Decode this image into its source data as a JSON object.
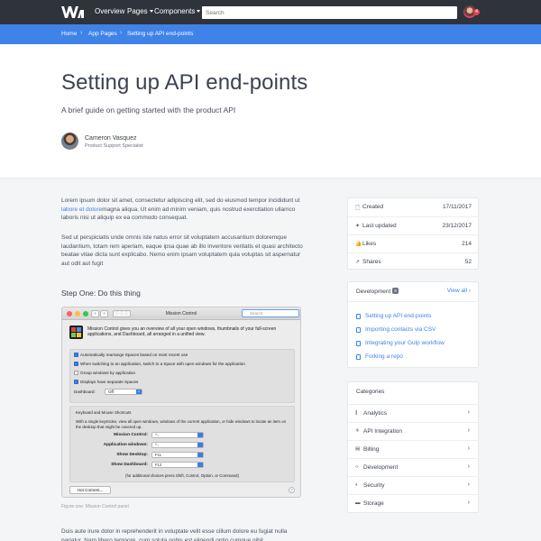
{
  "topbar": {
    "nav": [
      {
        "label": "Overview",
        "caret": false
      },
      {
        "label": "Pages",
        "caret": true
      },
      {
        "label": "Components",
        "caret": true
      }
    ],
    "search_placeholder": "Search",
    "notification_count": "4"
  },
  "breadcrumb": [
    "Home",
    "App Pages",
    "Setting up API end-points"
  ],
  "hero": {
    "title": "Setting up API end-points",
    "subtitle": "A brief guide on getting started with the product API",
    "author_name": "Cameron Vasquez",
    "author_role": "Product Support Specialist"
  },
  "article": {
    "p1_before": "Lorem ipsum dolor sit amet, consectetur adipiscing elit, sed do eiusmod tempor incididunt ut ",
    "p1_link": "labore et dolore",
    "p1_after": "magna aliqua. Ut enim ad minim veniam, quis nostrud exercitation ullamco laboris nisi ut aliquip ex ea commodo consequat.",
    "p2": "Sed ut perspiciatis unde omnis iste natus error sit voluptatem accusantium doloremque laudantium, totam rem aperiam, eaque ipsa quae ab illo inventore veritatis et quasi architecto beatae vitae dicta sunt explicabo. Nemo enim ipsam voluptatem quia voluptas sit aspernatur aut odit aut fugit",
    "step_title": "Step One: Do this thing",
    "caption": "Figure one: Mission Control panel",
    "p3": "Duis aute irure dolor in reprehenderit in voluptate velit esse cillum dolore eu fugiat nulla pariatur. Nam libero tempore, cum soluta nobis est eligendi optio cumque nihil"
  },
  "mac": {
    "title": "Mission Control",
    "search_placeholder": "Search",
    "grid_label": "⋮⋮⋮",
    "description": "Mission Control gives you an overview of all your open windows, thumbnails of your full-screen applications, and Dashboard, all arranged in a unified view.",
    "checkboxes": [
      {
        "label": "Automatically rearrange Spaces based on most recent use",
        "checked": true
      },
      {
        "label": "When switching to an application, switch to a Space with open windows for the application",
        "checked": true
      },
      {
        "label": "Group windows by application",
        "checked": false
      },
      {
        "label": "Displays have separate Spaces",
        "checked": true
      }
    ],
    "dashboard_label": "Dashboard:",
    "dashboard_value": "Off",
    "shortcuts_title": "Keyboard and Mouse Shortcuts",
    "shortcuts_desc": "With a single keystroke, view all open windows, windows of the current application, or hide windows to locate an item on the desktop that might be covered up.",
    "shortcuts": [
      {
        "label": "Mission Control:",
        "value": "^↑"
      },
      {
        "label": "Application windows:",
        "value": "^↓"
      },
      {
        "label": "Show Desktop:",
        "value": "F11"
      },
      {
        "label": "Show Dashboard:",
        "value": "F12"
      }
    ],
    "note": "(for additional choices press Shift, Control, Option, or Command)",
    "hot_corners": "Hot Corners...",
    "help": "?"
  },
  "meta": [
    {
      "icon": "🗋",
      "label": "Created",
      "value": "17/11/2017"
    },
    {
      "icon": "✦",
      "label": "Last updated",
      "value": "23/12/2017"
    },
    {
      "icon": "👍",
      "label": "Likes",
      "value": "214"
    },
    {
      "icon": "↗",
      "label": "Shares",
      "value": "52"
    }
  ],
  "development": {
    "title": "Development",
    "count": "6",
    "view_all": "View all ›",
    "links": [
      "Setting up API end-points",
      "Importing contacts via CSV",
      "Integrating your Gulp workflow",
      "Forking a repo"
    ]
  },
  "categories": {
    "title": "Categories",
    "items": [
      {
        "icon": "∥",
        "label": "Analytics"
      },
      {
        "icon": "✳",
        "label": "API Integration"
      },
      {
        "icon": "▤",
        "label": "Billing"
      },
      {
        "icon": "‹›",
        "label": "Development"
      },
      {
        "icon": "◐",
        "label": "Security"
      },
      {
        "icon": "▬",
        "label": "Storage"
      }
    ]
  },
  "colors": {
    "topbar": "#2f333b",
    "accent": "#3f83e8",
    "notification": "#e9434f"
  }
}
